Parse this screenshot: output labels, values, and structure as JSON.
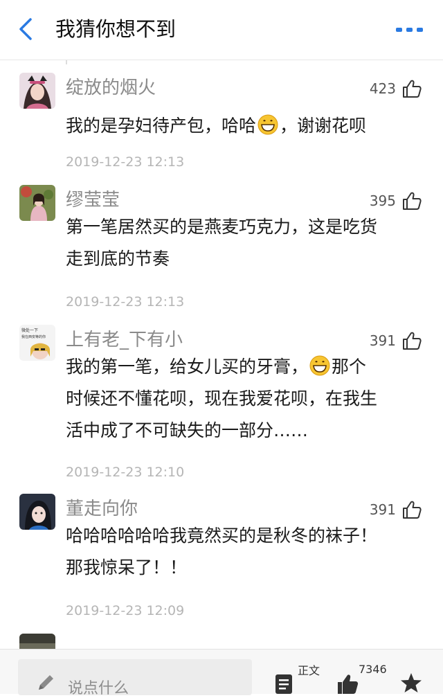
{
  "header": {
    "title": "我猜你想不到",
    "accent": "#2a7ae2"
  },
  "comments": [
    {
      "name": "绽放的烟火",
      "likes": "423",
      "text_before": "我的是孕妇待产包，哈哈",
      "text_after": "，谢谢花呗",
      "time": "2019-12-23 12:13"
    },
    {
      "name": "缪莹莹",
      "likes": "395",
      "text_line1": "第一笔居然买的是燕麦巧克力，这是吃货",
      "text_line2": "走到底的节奏",
      "time": "2019-12-23 12:13"
    },
    {
      "name": "上有老_下有小",
      "likes": "391",
      "text_line1_before": "我的第一笔，给女儿买的牙膏，",
      "text_line1_after": "那个",
      "text_line2": "时候还不懂花呗，现在我爱花呗，在我生",
      "text_line3": "活中成了不可缺失的一部分……",
      "avatar_text_1": "微处一下",
      "avatar_text_2": "我在西安等的你",
      "time": "2019-12-23 12:10"
    },
    {
      "name": "董走向你",
      "likes": "391",
      "text_line1": "哈哈哈哈哈哈我竟然买的是秋冬的袜子！",
      "text_line2": "那我惊呆了！！",
      "time": "2019-12-23 12:09"
    }
  ],
  "bottom_bar": {
    "input_placeholder": "说点什么",
    "article_label": "正文",
    "like_count": "7346"
  },
  "icons": {
    "back": "chevron-left-icon",
    "more": "more-dots-icon",
    "like": "thumbs-up-icon",
    "emoji": "grinning-face-icon",
    "pen": "pencil-icon",
    "article": "document-icon",
    "star": "star-icon"
  }
}
